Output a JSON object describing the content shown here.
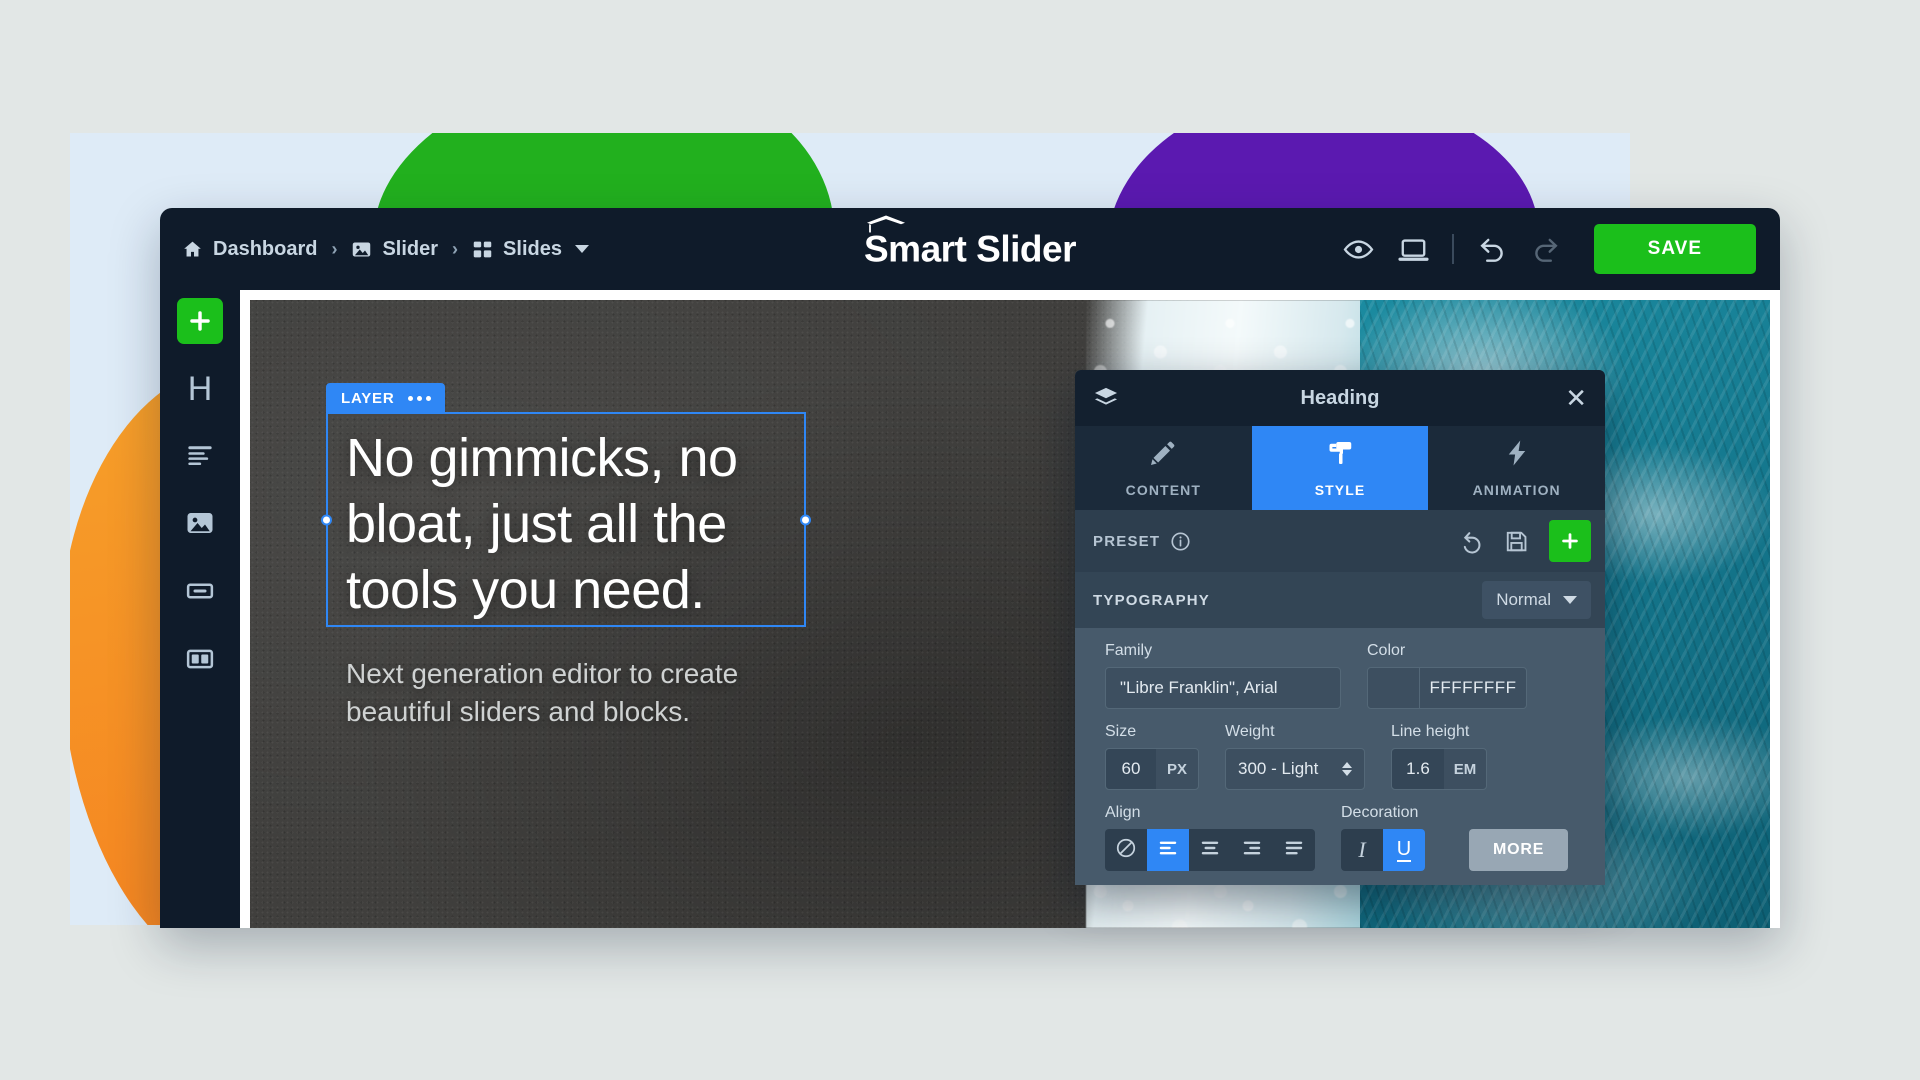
{
  "app": {
    "brand_name": "Smart Slider",
    "brand_icon": "graduation-cap-icon"
  },
  "breadcrumb": [
    {
      "label": "Dashboard",
      "icon": "home-icon"
    },
    {
      "label": "Slider",
      "icon": "image-icon"
    },
    {
      "label": "Slides",
      "icon": "grid-icon",
      "has_caret": true
    }
  ],
  "breadcrumb_separator": "›",
  "toolbar": {
    "preview_icon": "eye-icon",
    "device_icon": "laptop-icon",
    "undo_icon": "undo-icon",
    "redo_icon": "redo-icon",
    "save_label": "SAVE",
    "save_color": "#1bbf1b"
  },
  "left_rail": {
    "add_icon": "plus-icon",
    "items": [
      {
        "icon": "heading-icon",
        "glyph": "H"
      },
      {
        "icon": "text-lines-icon"
      },
      {
        "icon": "image-icon"
      },
      {
        "icon": "button-icon"
      },
      {
        "icon": "row-columns-icon"
      }
    ]
  },
  "canvas": {
    "layer_badge": "LAYER",
    "layer_menu_icon": "ellipsis-icon",
    "heading": "No gimmicks, no bloat, just all the tools you need.",
    "subheading": "Next generation editor to create beautiful sliders and blocks."
  },
  "style_panel": {
    "layers_icon": "layers-icon",
    "title": "Heading",
    "close_icon": "close-icon",
    "tabs": [
      {
        "label": "CONTENT",
        "icon": "pencil-icon",
        "active": false
      },
      {
        "label": "STYLE",
        "icon": "paint-roller-icon",
        "active": true
      },
      {
        "label": "ANIMATION",
        "icon": "lightning-icon",
        "active": false
      }
    ],
    "preset": {
      "label": "PRESET",
      "info_icon": "info-icon",
      "reset_icon": "reset-icon",
      "save_icon": "floppy-disk-icon",
      "add_icon": "plus-icon"
    },
    "typography": {
      "label": "TYPOGRAPHY",
      "state_value": "Normal",
      "state_caret_icon": "chevron-down-icon",
      "family_label": "Family",
      "family_value": "\"Libre Franklin\", Arial",
      "color_label": "Color",
      "color_value": "FFFFFFFF",
      "color_swatch": "#3d4f60",
      "size_label": "Size",
      "size_value": "60",
      "size_unit": "PX",
      "weight_label": "Weight",
      "weight_value": "300 - Light",
      "lineheight_label": "Line height",
      "lineheight_value": "1.6",
      "lineheight_unit": "EM",
      "align_label": "Align",
      "align_options": [
        {
          "icon": "align-none-icon",
          "active": false
        },
        {
          "icon": "align-left-icon",
          "active": true
        },
        {
          "icon": "align-center-icon",
          "active": false
        },
        {
          "icon": "align-right-icon",
          "active": false
        },
        {
          "icon": "align-justify-icon",
          "active": false
        }
      ],
      "decoration_label": "Decoration",
      "decoration_options": [
        {
          "icon": "italic-icon",
          "glyph": "I",
          "active": false
        },
        {
          "icon": "underline-icon",
          "glyph": "U",
          "active": true
        }
      ],
      "more_label": "MORE"
    }
  },
  "theme": {
    "accent_blue": "#2f87f5",
    "accent_green": "#1bbf1b",
    "panel_dark": "#13202f",
    "page_background": "#e2e7e6",
    "stage_background": "#deebf7"
  }
}
